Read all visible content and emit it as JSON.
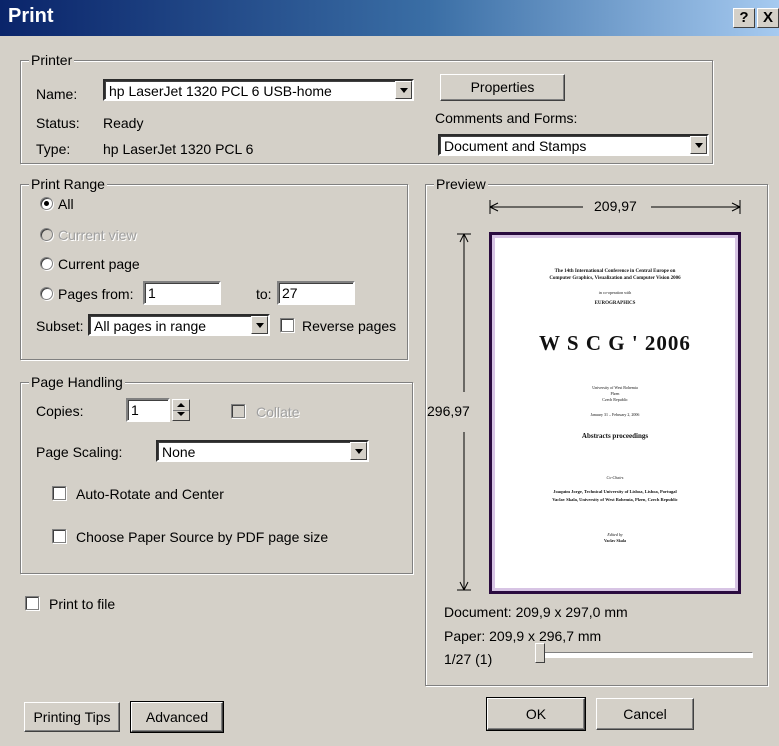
{
  "window": {
    "title": "Print",
    "help_label": "?",
    "close_label": "X"
  },
  "printer": {
    "group_label": "Printer",
    "name_label": "Name:",
    "name_value": "hp LaserJet 1320 PCL 6 USB-home",
    "status_label": "Status:",
    "status_value": "Ready",
    "type_label": "Type:",
    "type_value": "hp LaserJet 1320 PCL 6",
    "properties_label": "Properties",
    "comments_label": "Comments and Forms:",
    "comments_value": "Document and Stamps"
  },
  "print_range": {
    "group_label": "Print Range",
    "all_label": "All",
    "current_view_label": "Current view",
    "current_page_label": "Current page",
    "pages_from_label": "Pages from:",
    "from_value": "1",
    "to_label": "to:",
    "to_value": "27",
    "subset_label": "Subset:",
    "subset_value": "All pages in range",
    "reverse_label": "Reverse pages",
    "selected": "All"
  },
  "page_handling": {
    "group_label": "Page Handling",
    "copies_label": "Copies:",
    "copies_value": "1",
    "collate_label": "Collate",
    "scaling_label": "Page Scaling:",
    "scaling_value": "None",
    "autorotate_label": "Auto-Rotate and Center",
    "paper_source_label": "Choose Paper Source by PDF page size"
  },
  "print_to_file_label": "Print to file",
  "preview": {
    "group_label": "Preview",
    "width_dim": "209,97",
    "height_dim": "296,97",
    "document_size": "Document: 209,9 x 297,0 mm",
    "paper_size": "Paper: 209,9 x 296,7 mm",
    "page_counter": "1/27 (1)",
    "slider_fraction": 0.0,
    "page": {
      "line1": "The 14th International Conference in Central Europe on",
      "line2": "Computer Graphics, Visualization and Computer Vision 2006",
      "line3": "in co-operation with",
      "line4": "EUROGRAPHICS",
      "heading": "W S C G ' 2006",
      "place1": "University of West Bohemia",
      "place2": "Plzen",
      "place3": "Czech Republic",
      "dates": "January 31 – February 2, 2006",
      "subtitle": "Abstracts proceedings",
      "cochairs": "Co-Chairs",
      "chair1": "Joaquim Jorge, Technical University of Lisboa, Lisboa, Portugal",
      "chair2": "Vaclav Skala, University of West Bohemia, Plzen, Czech Republic",
      "edited": "Edited by",
      "editor": "Vaclav Skala"
    }
  },
  "buttons": {
    "printing_tips": "Printing Tips",
    "advanced": "Advanced",
    "ok": "OK",
    "cancel": "Cancel"
  }
}
